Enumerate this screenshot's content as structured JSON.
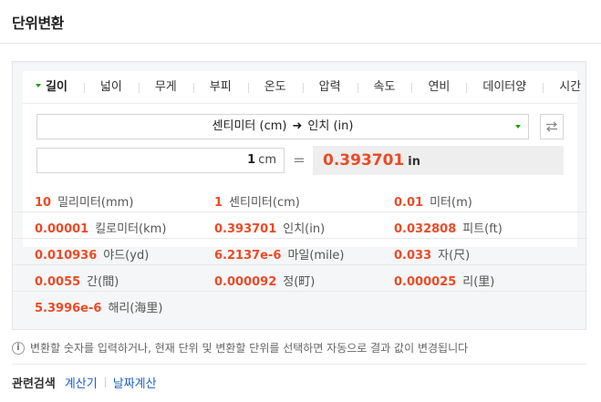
{
  "header": {
    "title": "단위변환"
  },
  "tabs": [
    {
      "label": "길이",
      "active": true
    },
    {
      "label": "넓이"
    },
    {
      "label": "무게"
    },
    {
      "label": "부피"
    },
    {
      "label": "온도"
    },
    {
      "label": "압력"
    },
    {
      "label": "속도"
    },
    {
      "label": "연비"
    },
    {
      "label": "데이터양"
    },
    {
      "label": "시간"
    }
  ],
  "converter": {
    "from_unit": "센티미터 (cm)",
    "arrow": "➜",
    "to_unit": "인치 (in)",
    "input_value": "1",
    "input_unit": "cm",
    "equals": "=",
    "result_value": "0.393701",
    "result_unit": "in"
  },
  "results": [
    {
      "value": "10",
      "unit": "밀리미터(mm)"
    },
    {
      "value": "1",
      "unit": "센티미터(cm)"
    },
    {
      "value": "0.01",
      "unit": "미터(m)"
    },
    {
      "value": "0.00001",
      "unit": "킬로미터(km)"
    },
    {
      "value": "0.393701",
      "unit": "인치(in)"
    },
    {
      "value": "0.032808",
      "unit": "피트(ft)"
    },
    {
      "value": "0.010936",
      "unit": "야드(yd)"
    },
    {
      "value": "6.2137e-6",
      "unit": "마일(mile)"
    },
    {
      "value": "0.033",
      "unit": "자(尺)"
    },
    {
      "value": "0.0055",
      "unit": "간(間)"
    },
    {
      "value": "0.000092",
      "unit": "정(町)"
    },
    {
      "value": "0.000025",
      "unit": "리(里)"
    },
    {
      "value": "5.3996e-6",
      "unit": "해리(海里)"
    }
  ],
  "info": {
    "icon": "info-icon",
    "text": "변환할 숫자를 입력하거나, 현재 단위 및 변환할 단위를 선택하면 자동으로 결과 값이 변경됩니다"
  },
  "related": {
    "label": "관련검색",
    "links": [
      "계산기",
      "날짜계산"
    ]
  },
  "colors": {
    "accent": "#19a500",
    "result": "#ec4a26",
    "link": "#1a5fcc"
  }
}
